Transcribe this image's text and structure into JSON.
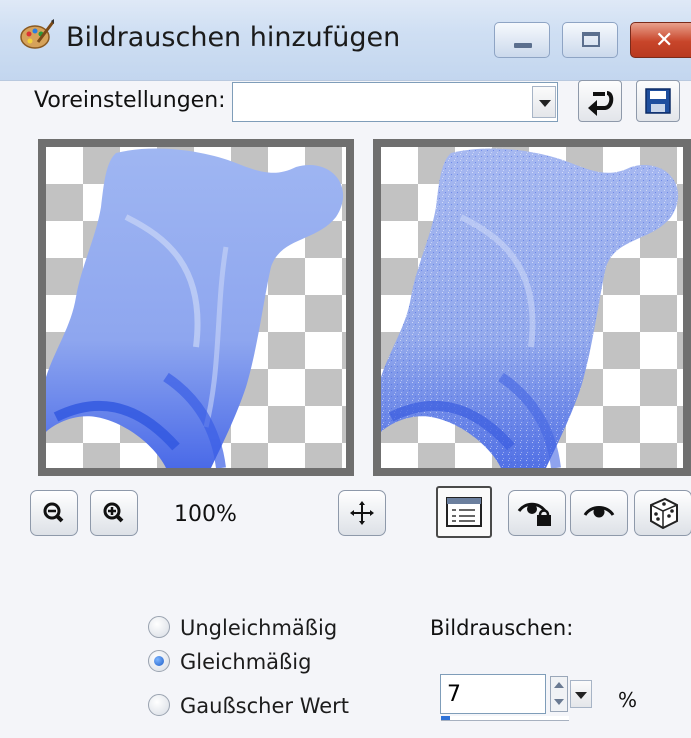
{
  "window": {
    "title": "Bildrauschen hinzufügen",
    "close_glyph": "✕"
  },
  "presets": {
    "label": "Voreinstellungen:",
    "value": ""
  },
  "preview": {
    "zoom_level": "100%"
  },
  "noise": {
    "options": [
      {
        "label": "Ungleichmäßig",
        "checked": false
      },
      {
        "label": "Gleichmäßig",
        "checked": true
      },
      {
        "label": "Gaußscher Wert",
        "checked": false
      }
    ],
    "amount_label": "Bildrauschen:",
    "amount_value": "7",
    "amount_unit": "%",
    "amount_fraction": 0.07
  },
  "colors": {
    "shape_blue": "#8fa9f0",
    "shape_deep": "#3c5fe6",
    "checker": "#c2c2c2",
    "titlebar": "#cfdff3"
  }
}
